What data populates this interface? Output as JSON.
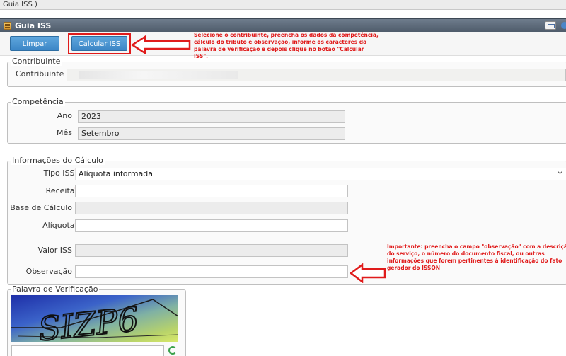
{
  "tab": {
    "label": "Guia ISS )"
  },
  "window": {
    "title": "Guia ISS"
  },
  "toolbar": {
    "limpar_label": "Limpar",
    "calcular_label": "Calcular ISS"
  },
  "notes": {
    "top": "Selecione o contribuinte, preencha os dados da competência, cálculo do tributo e observação, informe os caracteres da palavra de verificação e depois clique no botão \"Calcular ISS\".",
    "obs": "Importante: preencha o campo \"observação\" com a descrição do serviço, o número do documento fiscal, ou outras informações que forem pertinentes à identificação do fato gerador do ISSQN"
  },
  "contribuinte": {
    "legend": "Contribuinte",
    "label": "Contribuinte",
    "value": ""
  },
  "competencia": {
    "legend": "Competência",
    "ano_label": "Ano",
    "ano_value": "2023",
    "mes_label": "Mês",
    "mes_value": "Setembro"
  },
  "calculo": {
    "legend": "Informações do Cálculo",
    "tipo_label": "Tipo ISS",
    "tipo_value": "Alíquota informada",
    "receita_label": "Receita",
    "base_label": "Base de Cálculo",
    "aliquota_label": "Alíquota",
    "valor_label": "Valor ISS",
    "obs_label": "Observação",
    "required_mark": "*"
  },
  "verificacao": {
    "legend": "Palavra de Verificação",
    "captcha_text": "SIZP6"
  },
  "colors": {
    "accent": "#3b86c6",
    "highlight": "#e01b1b",
    "titlebar": "#5a6776"
  }
}
